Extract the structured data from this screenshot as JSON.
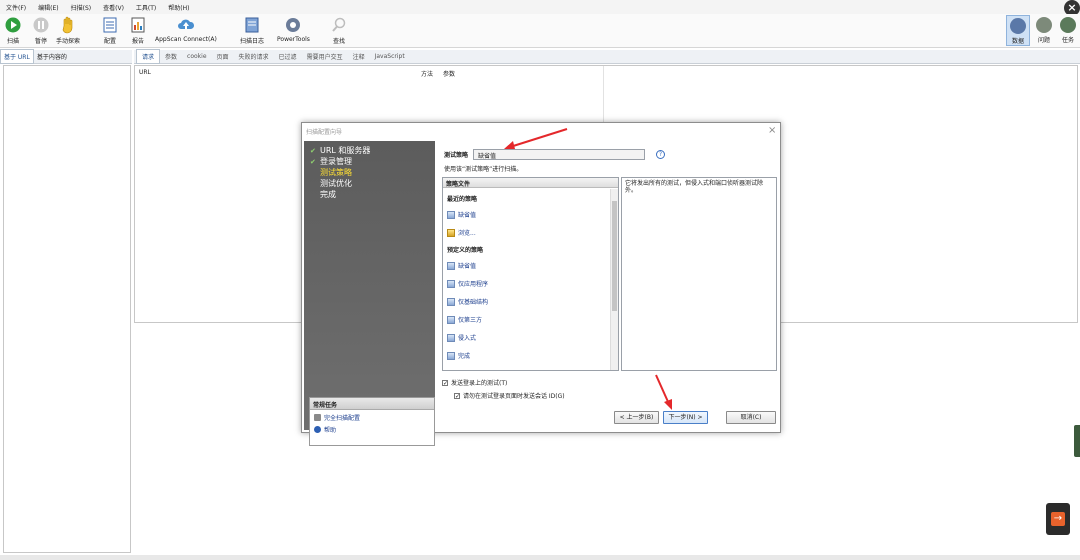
{
  "menu": [
    "文件(F)",
    "编辑(E)",
    "扫描(S)",
    "查看(V)",
    "工具(T)",
    "帮助(H)"
  ],
  "toolbar": {
    "scan": "扫描",
    "pause": "暂停",
    "manual_explore": "手动探索",
    "config": "配置",
    "report": "报告",
    "appscan_connect": "AppScan Connect(A)",
    "scan_log": "扫描日志",
    "powertools": "PowerTools",
    "locate": "查找",
    "data": "数据",
    "issues": "问题",
    "tasks": "任务"
  },
  "left_tabs": [
    "基于 URL",
    "基于内容的"
  ],
  "right_tabs": [
    "请求",
    "参数",
    "cookie",
    "页面",
    "失败的请求",
    "已过滤",
    "需要用户交互",
    "注释",
    "JavaScript"
  ],
  "grid": {
    "col_url": "URL",
    "col_method": "方法",
    "col_params": "参数"
  },
  "dialog": {
    "title": "扫描配置向导",
    "steps": [
      {
        "label": "URL 和服务器",
        "done": true
      },
      {
        "label": "登录管理",
        "done": true
      },
      {
        "label": "测试策略",
        "current": true
      },
      {
        "label": "测试优化"
      },
      {
        "label": "完成"
      }
    ],
    "tasks_header": "常规任务",
    "task_items": [
      "完全扫描配置",
      "帮助"
    ],
    "policy_label": "测试策略",
    "policy_value": "缺省值",
    "instruction": "使用该“测试策略”进行扫描。",
    "list_header": "策略文件",
    "recent_group": "最近的策略",
    "recent_items": [
      "缺省值",
      "浏览..."
    ],
    "predefined_group": "预定义的策略",
    "predefined_items": [
      "缺省值",
      "仅应用程序",
      "仅基础结构",
      "仅第三方",
      "侵入式",
      "完成"
    ],
    "description": "它将发出所有的测试，但侵入式和端口侦听器测试除外。",
    "checkbox_send_login": "发送登录上的测试(T)",
    "checkbox_session": "请勿在测试登录页面时发送会话 ID(G)",
    "btn_back": "< 上一步(B)",
    "btn_next": "下一步(N) >",
    "btn_cancel": "取消(C)",
    "help_mark": "?"
  },
  "colors": {
    "accent_arrow": "#e4282b",
    "wizard_side": "#666666",
    "current_step": "#ffe033"
  }
}
